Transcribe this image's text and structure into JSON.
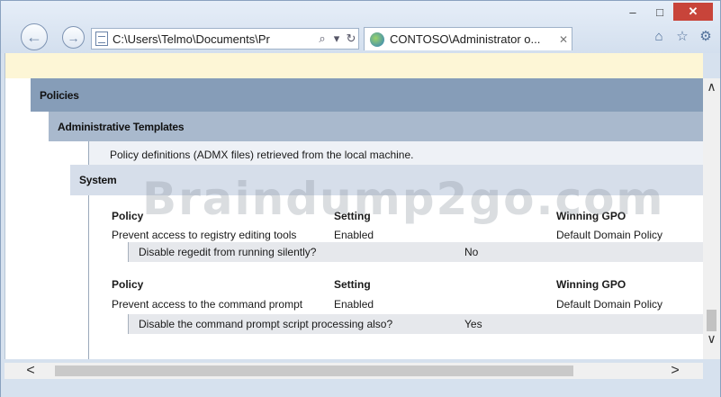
{
  "window": {
    "minimize": "–",
    "maximize": "□",
    "close": "✕"
  },
  "nav": {
    "back": "←",
    "forward": "→"
  },
  "address_bar": {
    "url": "C:\\Users\\Telmo\\Documents\\Pr",
    "search": "⌕",
    "dropdown": "▾",
    "refresh": "↻"
  },
  "tab": {
    "title": "CONTOSO\\Administrator o...",
    "close": "✕"
  },
  "toolbar": {
    "home": "⌂",
    "favorites": "☆",
    "settings": "⚙"
  },
  "report": {
    "policies": "Policies",
    "admin_templates": "Administrative Templates",
    "description": "Policy definitions (ADMX files) retrieved from the local machine.",
    "system": "System",
    "watermark": "Braindump2go.com",
    "tables": [
      {
        "headers": {
          "policy": "Policy",
          "setting": "Setting",
          "winning": "Winning GPO"
        },
        "row": {
          "policy": "Prevent access to registry editing tools",
          "setting": "Enabled",
          "winning": "Default Domain Policy"
        },
        "sub": {
          "label": "Disable regedit from running silently?",
          "value": "No"
        }
      },
      {
        "headers": {
          "policy": "Policy",
          "setting": "Setting",
          "winning": "Winning GPO"
        },
        "row": {
          "policy": "Prevent access to the command prompt",
          "setting": "Enabled",
          "winning": "Default Domain Policy"
        },
        "sub": {
          "label": "Disable the command prompt script processing also?",
          "value": "Yes"
        }
      }
    ]
  },
  "scrollbars": {
    "up": "∧",
    "down": "∨",
    "left": "<",
    "right": ">"
  },
  "colors": {
    "policies_bg": "#869db8",
    "admin_bg": "#a9b9cd",
    "system_bg": "#d6deea",
    "close_btn": "#c8443a"
  }
}
